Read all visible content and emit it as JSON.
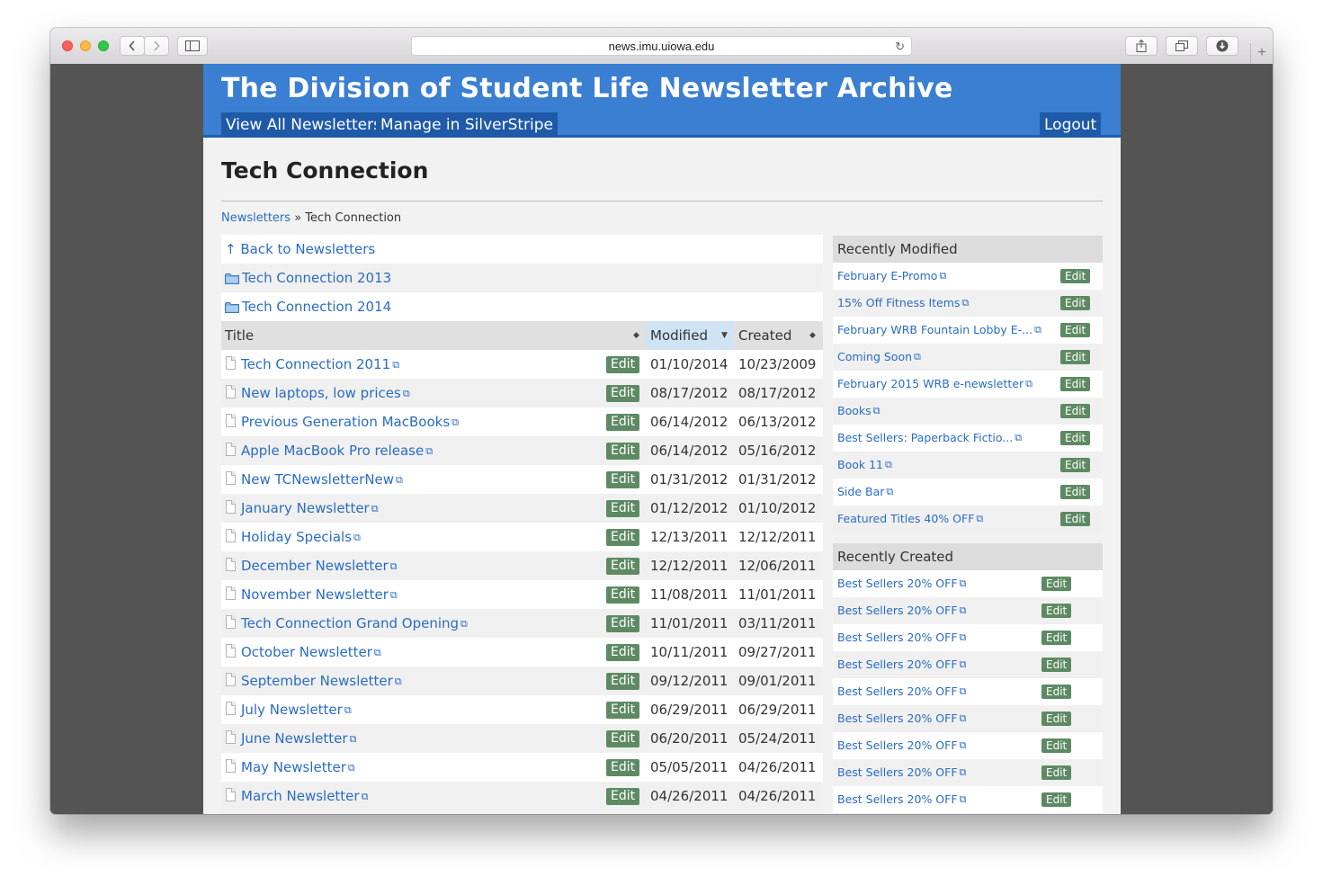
{
  "browser": {
    "url": "news.imu.uiowa.edu",
    "new_tab_symbol": "+"
  },
  "site": {
    "title": "The Division of Student Life Newsletter Archive",
    "nav": {
      "view_all": "View All Newsletters",
      "manage": "Manage in SilverStripe",
      "logout": "Logout"
    }
  },
  "page": {
    "title": "Tech Connection",
    "breadcrumb": {
      "link": "Newsletters",
      "separator": "»",
      "current": "Tech Connection"
    }
  },
  "list": {
    "back_label": "↑ Back to Newsletters",
    "folders": [
      "Tech Connection 2013",
      "Tech Connection 2014"
    ],
    "columns": {
      "title": "Title",
      "modified": "Modified",
      "created": "Created"
    },
    "edit_label": "Edit",
    "rows": [
      {
        "title": "Tech Connection 2011",
        "modified": "01/10/2014",
        "created": "10/23/2009"
      },
      {
        "title": "New laptops, low prices",
        "modified": "08/17/2012",
        "created": "08/17/2012"
      },
      {
        "title": "Previous Generation MacBooks",
        "modified": "06/14/2012",
        "created": "06/13/2012"
      },
      {
        "title": "Apple MacBook Pro release",
        "modified": "06/14/2012",
        "created": "05/16/2012"
      },
      {
        "title": "New TCNewsletterNew",
        "modified": "01/31/2012",
        "created": "01/31/2012"
      },
      {
        "title": "January Newsletter",
        "modified": "01/12/2012",
        "created": "01/10/2012"
      },
      {
        "title": "Holiday Specials",
        "modified": "12/13/2011",
        "created": "12/12/2011"
      },
      {
        "title": "December Newsletter",
        "modified": "12/12/2011",
        "created": "12/06/2011"
      },
      {
        "title": "November Newsletter",
        "modified": "11/08/2011",
        "created": "11/01/2011"
      },
      {
        "title": "Tech Connection Grand Opening",
        "modified": "11/01/2011",
        "created": "03/11/2011"
      },
      {
        "title": "October Newsletter",
        "modified": "10/11/2011",
        "created": "09/27/2011"
      },
      {
        "title": "September Newsletter",
        "modified": "09/12/2011",
        "created": "09/01/2011"
      },
      {
        "title": "July Newsletter",
        "modified": "06/29/2011",
        "created": "06/29/2011"
      },
      {
        "title": "June Newsletter",
        "modified": "06/20/2011",
        "created": "05/24/2011"
      },
      {
        "title": "May Newsletter",
        "modified": "05/05/2011",
        "created": "04/26/2011"
      },
      {
        "title": "March Newsletter",
        "modified": "04/26/2011",
        "created": "04/26/2011"
      }
    ]
  },
  "sidebar": {
    "recently_modified": {
      "heading": "Recently Modified",
      "items": [
        "February E-Promo",
        "15% Off Fitness Items",
        "February WRB Fountain Lobby E-...",
        "Coming Soon",
        "February 2015 WRB e-newsletter",
        "Books",
        "Best Sellers: Paperback Fictio...",
        "Book 11",
        "Side Bar",
        "Featured Titles 40% OFF"
      ]
    },
    "recently_created": {
      "heading": "Recently Created",
      "items": [
        "Best Sellers 20% OFF",
        "Best Sellers 20% OFF",
        "Best Sellers 20% OFF",
        "Best Sellers 20% OFF",
        "Best Sellers 20% OFF",
        "Best Sellers 20% OFF",
        "Best Sellers 20% OFF",
        "Best Sellers 20% OFF",
        "Best Sellers 20% OFF"
      ]
    },
    "edit_label": "Edit"
  },
  "colors": {
    "header": "#3a7fd1",
    "nav_button": "#1f5aa8",
    "link": "#2a6cc4",
    "edit_button": "#5e8a63"
  },
  "icons": {
    "external_link": "external-link-icon",
    "document": "document-icon",
    "folder": "folder-icon"
  }
}
